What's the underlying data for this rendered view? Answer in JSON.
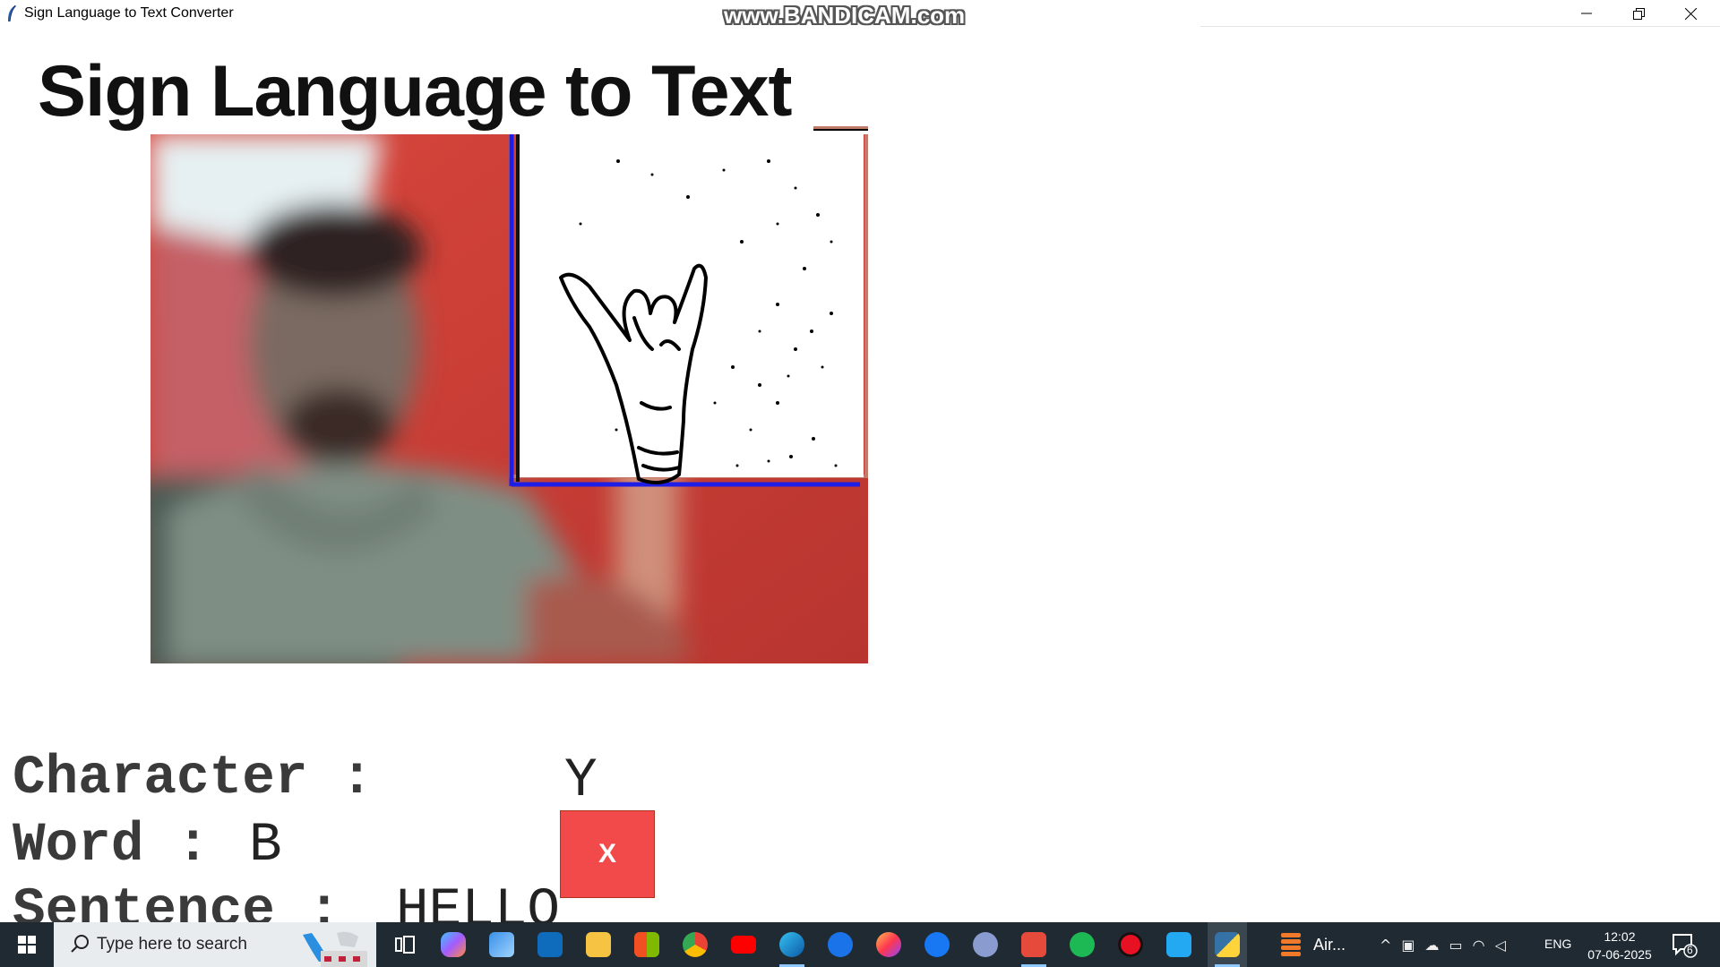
{
  "window": {
    "title": "Sign Language to Text Converter",
    "controls": {
      "minimize": "minimize-icon",
      "restore": "restore-icon",
      "close": "close-icon"
    }
  },
  "watermark": "www.BANDICAM.com",
  "app": {
    "heading": "Sign Language to Text",
    "character_label": "Character :",
    "character_value": "Y",
    "word_label": "Word :",
    "word_value": "B",
    "sentence_label": "Sentence :",
    "sentence_value": "HELLO",
    "clear_button": "X",
    "colors": {
      "clear_button": "#f24a4a",
      "roi_border": "#1e1ee6",
      "camera_bg": "#c8403a"
    }
  },
  "taskbar": {
    "search_placeholder": "Type here to search",
    "pinned": [
      "task-view-icon",
      "copilot-icon",
      "laptop-icon",
      "outlook-icon",
      "file-explorer-icon",
      "microsoft-store-icon",
      "chrome-icon",
      "youtube-icon",
      "edge-icon",
      "app-icon",
      "firefox-icon",
      "facebook-icon",
      "r-icon",
      "brave-icon",
      "spotify-icon",
      "record-icon",
      "vscode-icon",
      "python-icon"
    ],
    "running_label": "Air...",
    "tray": {
      "language": "ENG",
      "time": "12:02",
      "date": "07-06-2025",
      "notifications": "6"
    }
  }
}
